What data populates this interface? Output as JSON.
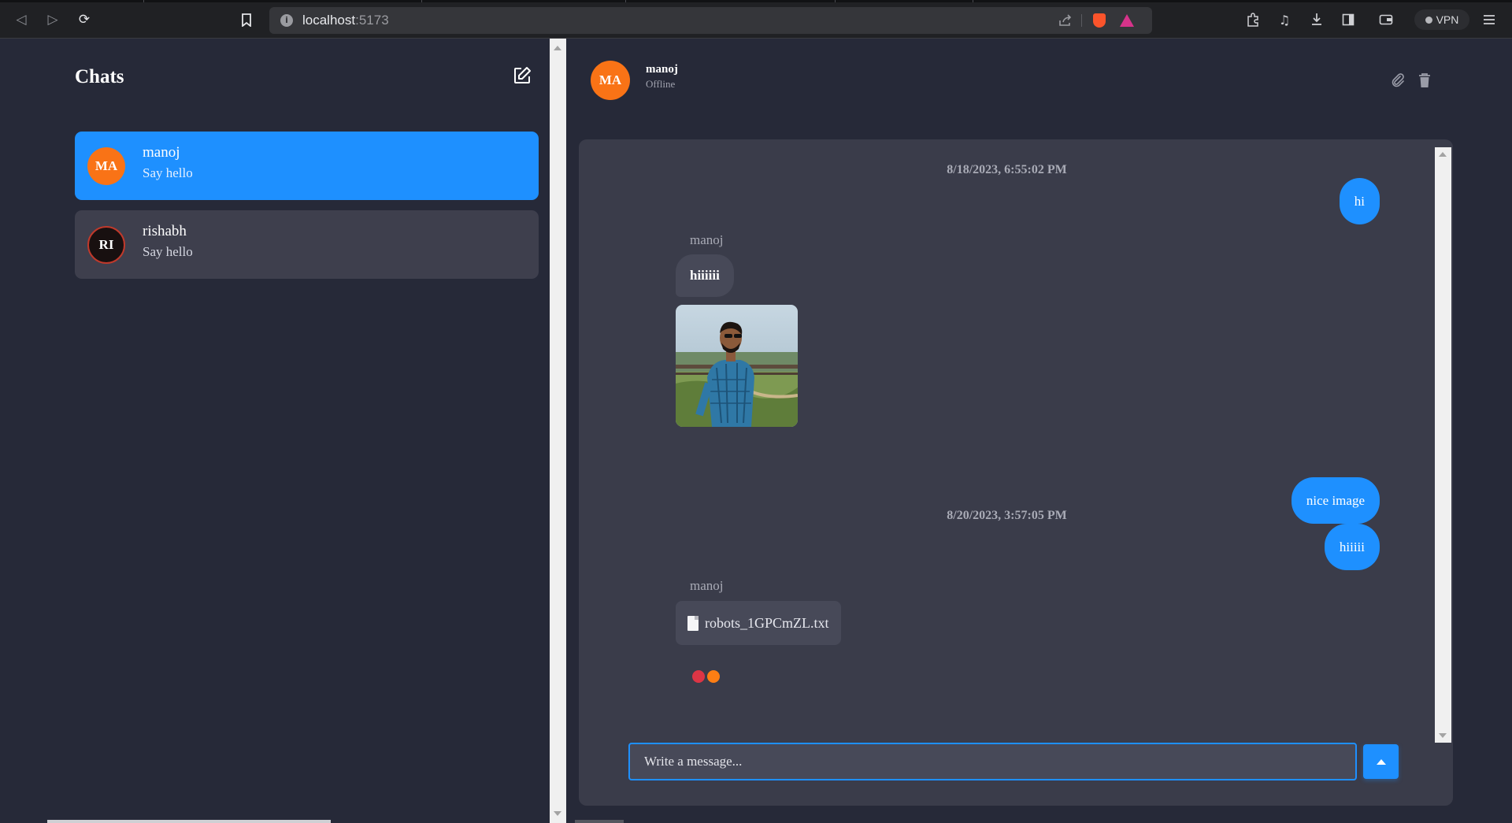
{
  "browser": {
    "url_host": "localhost",
    "url_port": ":5173",
    "vpn_label": "VPN"
  },
  "sidebar": {
    "title": "Chats",
    "chats": [
      {
        "initials": "MA",
        "name": "manoj",
        "preview": "Say hello",
        "active": true,
        "avatar_color": "#f97316"
      },
      {
        "initials": "RI",
        "name": "rishabh",
        "preview": "Say hello",
        "active": false,
        "avatar_color": "#181010"
      }
    ]
  },
  "chat": {
    "header": {
      "initials": "MA",
      "name": "manoj",
      "status": "Offline"
    },
    "timestamps": [
      "8/18/2023, 6:55:02 PM",
      "8/20/2023, 3:57:05 PM"
    ],
    "messages": {
      "out_1": "hi",
      "in_sender_1": "manoj",
      "in_1": "hiiiiii",
      "out_2": "nice image",
      "out_3": "hiiiii",
      "in_sender_2": "manoj",
      "file_name": "robots_1GPCmZL.txt"
    },
    "reaction_colors": [
      "#dc3545",
      "#fd7e14"
    ],
    "composer": {
      "placeholder": "Write a message..."
    }
  },
  "colors": {
    "accent": "#1e90ff",
    "avatar_orange": "#f97316",
    "background": "#262938",
    "panel": "#3a3c4a"
  }
}
